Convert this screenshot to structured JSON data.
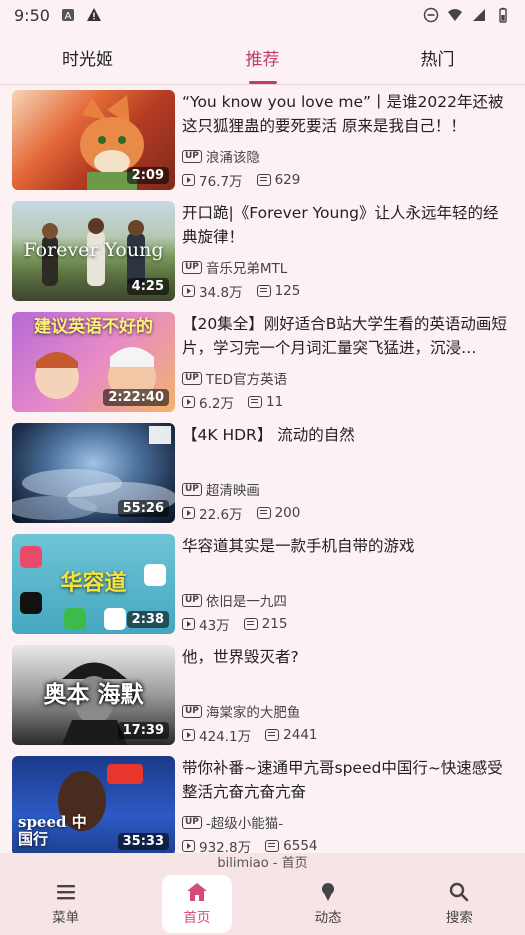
{
  "status_bar": {
    "time": "9:50"
  },
  "tabs": [
    {
      "label": "时光姬",
      "active": false
    },
    {
      "label": "推荐",
      "active": true
    },
    {
      "label": "热门",
      "active": false
    }
  ],
  "videos": [
    {
      "title": "“You know you love me”丨是谁2022年还被这只狐狸蛊的要死要活 原来是我自己！！",
      "uploader": "浪涌该隐",
      "plays": "76.7万",
      "danmaku": "629",
      "duration": "2:09",
      "thumb_text": ""
    },
    {
      "title": "开口跪|《Forever Young》让人永远年轻的经典旋律！",
      "uploader": "音乐兄弟MTL",
      "plays": "34.8万",
      "danmaku": "125",
      "duration": "4:25",
      "thumb_text": "Forever Young"
    },
    {
      "title": "【20集全】刚好适合B站大学生看的英语动画短片，学习完一个月词汇量突飞猛进，沉浸…",
      "uploader": "TED官方英语",
      "plays": "6.2万",
      "danmaku": "11",
      "duration": "2:22:40",
      "thumb_text": "建议英语不好的"
    },
    {
      "title": "【4K HDR】 流动的自然",
      "uploader": "超清映画",
      "plays": "22.6万",
      "danmaku": "200",
      "duration": "55:26",
      "thumb_text": ""
    },
    {
      "title": "华容道其实是一款手机自带的游戏",
      "uploader": "依旧是一九四",
      "plays": "43万",
      "danmaku": "215",
      "duration": "2:38",
      "thumb_text": "华容道"
    },
    {
      "title": "他，世界毁灭者?",
      "uploader": "海棠家的大肥鱼",
      "plays": "424.1万",
      "danmaku": "2441",
      "duration": "17:39",
      "thumb_text": "奥本  海默"
    },
    {
      "title": "带你补番~速通甲亢哥speed中国行~快速感受整活亢奋亢奋亢奋",
      "uploader": "-超级小能猫-",
      "plays": "932.8万",
      "danmaku": "6554",
      "duration": "35:33",
      "thumb_text": "speed 中国行"
    }
  ],
  "bottom_bar": {
    "app_title": "bilimiao - 首页",
    "items": [
      {
        "label": "菜单",
        "icon": "menu-icon",
        "active": false
      },
      {
        "label": "首页",
        "icon": "home-icon",
        "active": true
      },
      {
        "label": "动态",
        "icon": "dynamic-icon",
        "active": false
      },
      {
        "label": "搜索",
        "icon": "search-icon",
        "active": false
      }
    ]
  },
  "colors": {
    "accent": "#c23b6a",
    "background": "#fdf2f3"
  }
}
